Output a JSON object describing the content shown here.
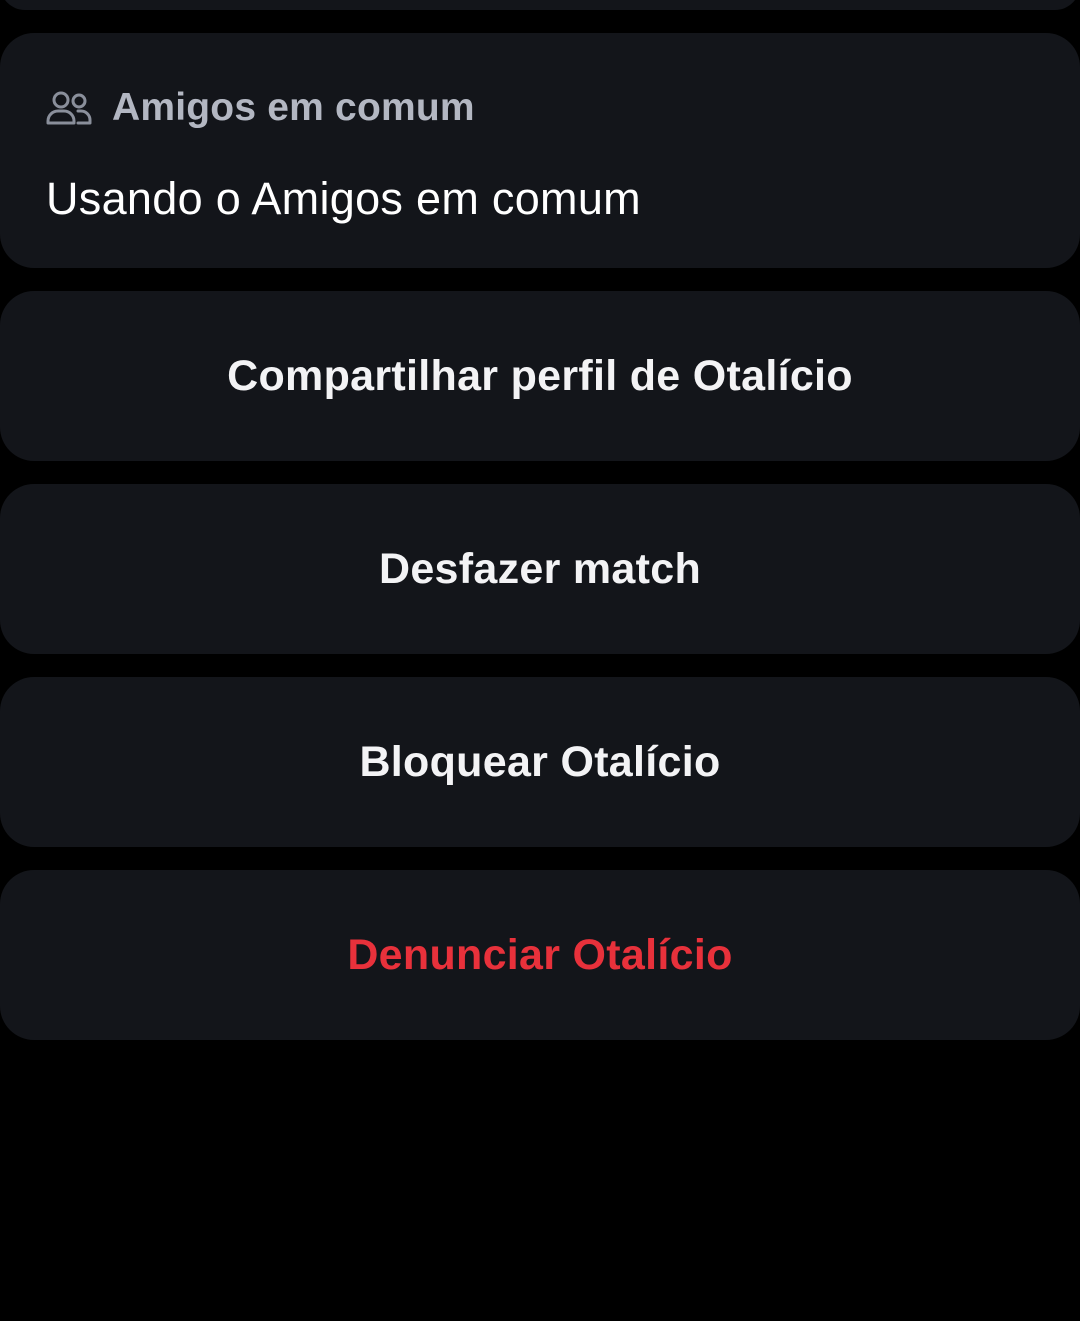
{
  "mutual_friends": {
    "icon": "people-icon",
    "title": "Amigos em comum",
    "body": "Usando o Amigos em comum"
  },
  "actions": [
    {
      "label": "Compartilhar perfil de Otalício",
      "style": "default"
    },
    {
      "label": "Desfazer match",
      "style": "default"
    },
    {
      "label": "Bloquear Otalício",
      "style": "default"
    },
    {
      "label": "Denunciar Otalício",
      "style": "danger"
    }
  ],
  "colors": {
    "background": "#000000",
    "card": "#13151a",
    "muted_text": "#b3b7c2",
    "primary_text": "#f3f3f5",
    "danger": "#e8313b"
  }
}
